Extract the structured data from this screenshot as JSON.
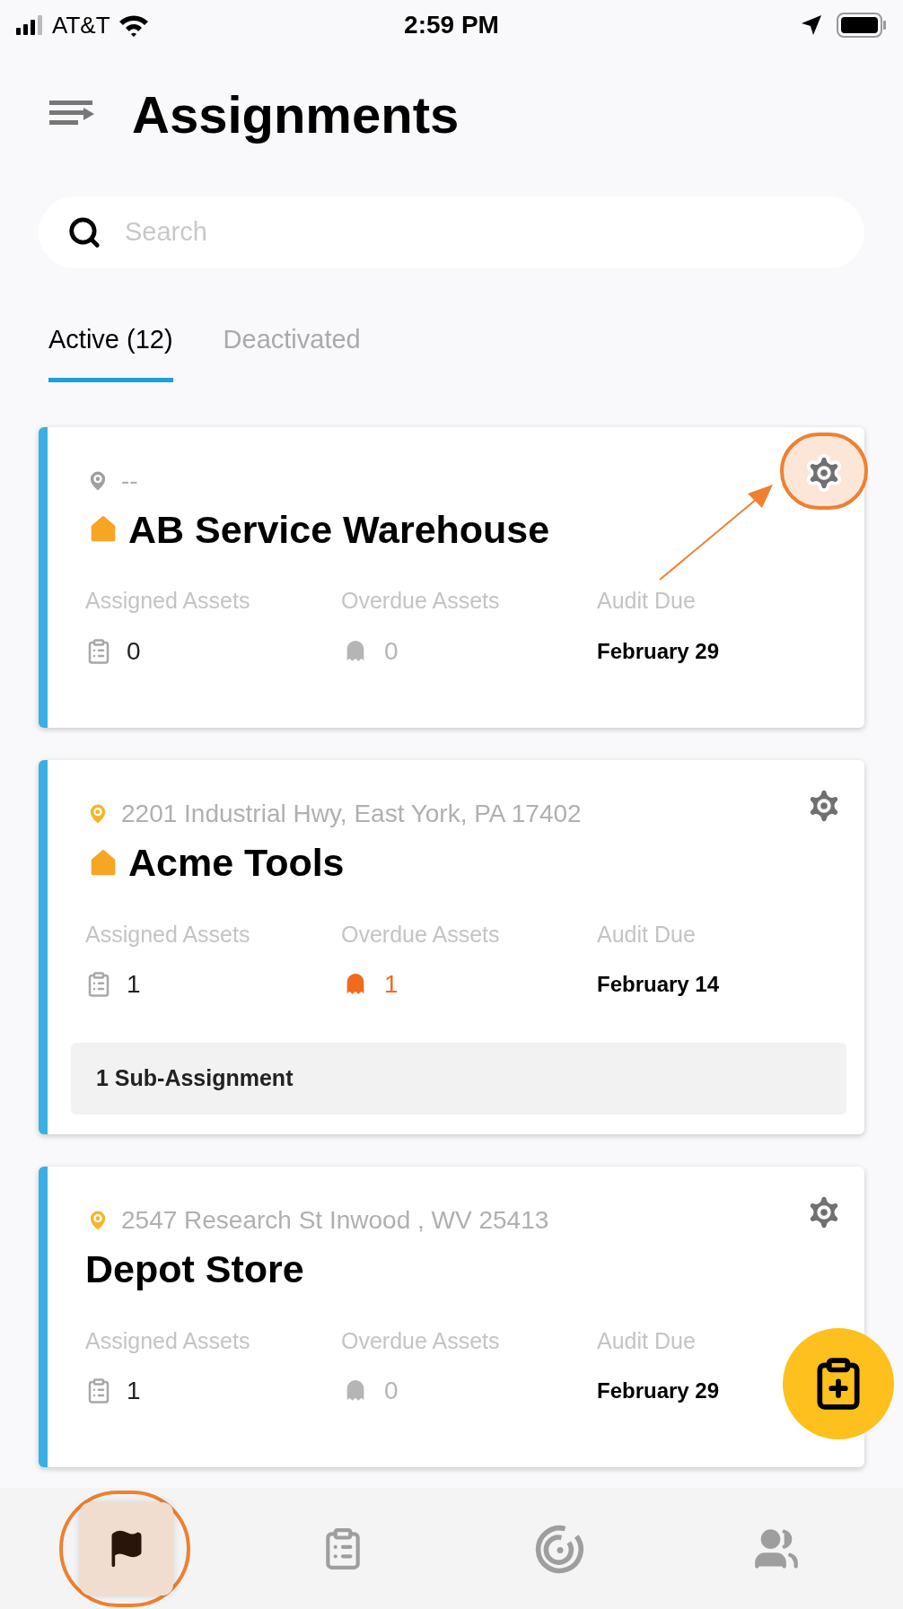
{
  "status_bar": {
    "carrier": "AT&T",
    "time": "2:59 PM"
  },
  "header": {
    "title": "Assignments"
  },
  "search": {
    "placeholder": "Search"
  },
  "tabs": [
    {
      "label": "Active (12)",
      "selected": true
    },
    {
      "label": "Deactivated",
      "selected": false
    }
  ],
  "cards": [
    {
      "address": "--",
      "address_set": false,
      "home": true,
      "name": "AB Service Warehouse",
      "settings_highlighted": true,
      "stats": {
        "assigned_label": "Assigned Assets",
        "assigned": "0",
        "overdue_label": "Overdue Assets",
        "overdue": "0",
        "overdue_alert": false,
        "audit_label": "Audit Due",
        "audit": "February 29"
      }
    },
    {
      "address": "2201 Industrial Hwy, East York, PA 17402",
      "address_set": true,
      "home": true,
      "name": "Acme Tools",
      "settings_highlighted": false,
      "stats": {
        "assigned_label": "Assigned Assets",
        "assigned": "1",
        "overdue_label": "Overdue Assets",
        "overdue": "1",
        "overdue_alert": true,
        "audit_label": "Audit Due",
        "audit": "February 14"
      },
      "sub_assignments": "1 Sub-Assignment"
    },
    {
      "address": "2547 Research St  Inwood , WV 25413",
      "address_set": true,
      "home": false,
      "name": "Depot Store",
      "settings_highlighted": false,
      "stats": {
        "assigned_label": "Assigned Assets",
        "assigned": "1",
        "overdue_label": "Overdue Assets",
        "overdue": "0",
        "overdue_alert": false,
        "audit_label": "Audit Due",
        "audit": "February 29"
      }
    }
  ],
  "nav": [
    {
      "kind": "flag",
      "selected": true,
      "highlighted": true
    },
    {
      "kind": "clipboard",
      "selected": false,
      "highlighted": false
    },
    {
      "kind": "radar",
      "selected": false,
      "highlighted": false
    },
    {
      "kind": "people",
      "selected": false,
      "highlighted": false
    }
  ]
}
